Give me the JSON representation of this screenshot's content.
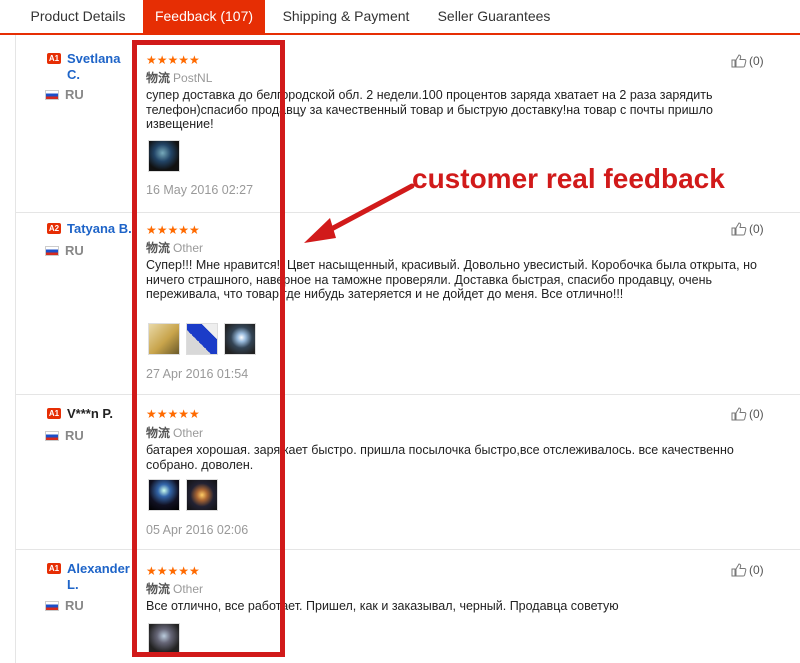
{
  "tabs": [
    {
      "label": "Product Details"
    },
    {
      "label": "Feedback (107)"
    },
    {
      "label": "Shipping & Payment"
    },
    {
      "label": "Seller Guarantees"
    }
  ],
  "annotation": "customer real feedback",
  "reviews": [
    {
      "level": "A1",
      "name_line1": "Svetlana",
      "name_line2": "C.",
      "country": "RU",
      "stars": "★★★★★",
      "logistics_label": "物流",
      "logistics": "PostNL",
      "text": "супер доставка до белгородской обл. 2 недели.100 процентов заряда хватает на 2 раза зарядить телефон)спасибо продавцу за качественный товар и быструю доставку!на товар с почты пришло извещение!",
      "date": "16 May 2016 02:27",
      "useful": "(0)"
    },
    {
      "level": "A2",
      "name_line1": "Tatyana B.",
      "name_line2": "",
      "country": "RU",
      "stars": "★★★★★",
      "logistics_label": "物流",
      "logistics": "Other",
      "text": "Супер!!! Мне нравится!! Цвет насыщенный, красивый. Довольно увесистый. Коробочка была открыта, но ничего страшного, наверное на таможне проверяли. Доставка быстрая, спасибо продавцу, очень переживала, что товар где нибудь затеряется и не дойдет до меня. Все отлично!!!",
      "date": "27 Apr 2016 01:54",
      "useful": "(0)"
    },
    {
      "level": "A1",
      "name_line1": "V***n P.",
      "name_line2": "",
      "country": "RU",
      "stars": "★★★★★",
      "logistics_label": "物流",
      "logistics": "Other",
      "text": "батарея хорошая. заряжает быстро. пришла посылочка быстро,все отслеживалось. все качественно собрано. доволен.",
      "date": "05 Apr 2016 02:06",
      "useful": "(0)"
    },
    {
      "level": "A1",
      "name_line1": "Alexander",
      "name_line2": "L.",
      "country": "RU",
      "stars": "★★★★★",
      "logistics_label": "物流",
      "logistics": "Other",
      "text": "Все отлично, все работает. Пришел, как и заказывал, черный. Продавца советую",
      "date": "",
      "useful": "(0)"
    }
  ]
}
